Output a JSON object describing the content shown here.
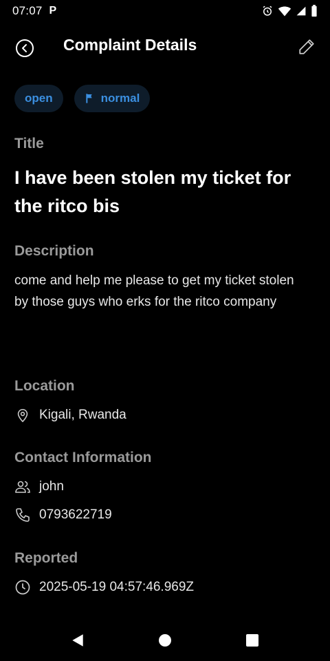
{
  "status_bar": {
    "time": "07:07",
    "app_indicator": "P",
    "icons": [
      "alarm-icon",
      "wifi-icon",
      "signal-icon",
      "battery-icon"
    ]
  },
  "header": {
    "title": "Complaint Details",
    "back_icon": "back-circle-icon",
    "edit_icon": "edit-pencil-icon"
  },
  "chips": {
    "status": "open",
    "priority": "normal",
    "priority_icon": "flag-icon",
    "chip_color": "#3b8fe0",
    "chip_bg": "#0e1c2a"
  },
  "complaint": {
    "title_label": "Title",
    "title": "I have been stolen my ticket for the ritco bis",
    "description_label": "Description",
    "description": "come and help me please to get my ticket stolen by those guys who erks for the ritco company",
    "location_label": "Location",
    "location": "Kigali, Rwanda",
    "contact_label": "Contact Information",
    "contact_name": "john",
    "contact_phone": "0793622719",
    "reported_label": "Reported",
    "reported_at": "2025-05-19 04:57:46.969Z"
  },
  "nav": {
    "back": "nav-back-icon",
    "home": "nav-home-icon",
    "recents": "nav-recents-icon"
  }
}
